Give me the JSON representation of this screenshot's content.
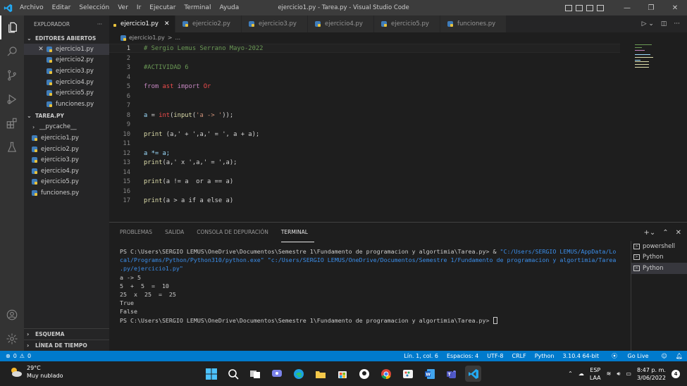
{
  "titlebar": {
    "menu": [
      "Archivo",
      "Editar",
      "Selección",
      "Ver",
      "Ir",
      "Ejecutar",
      "Terminal",
      "Ayuda"
    ],
    "window_title": "ejercicio1.py - Tarea.py - Visual Studio Code"
  },
  "sidebar": {
    "header": "EXPLORADOR",
    "open_editors_label": "EDITORES ABIERTOS",
    "open_editors": [
      "ejercicio1.py",
      "ejercicio2.py",
      "ejercicio3.py",
      "ejercicio4.py",
      "ejercicio5.py",
      "funciones.py"
    ],
    "folder_label": "TAREA.PY",
    "folder_items": [
      "__pycache__",
      "ejercicio1.py",
      "ejercicio2.py",
      "ejercicio3.py",
      "ejercicio4.py",
      "ejercicio5.py",
      "funciones.py"
    ],
    "outline_label": "ESQUEMA",
    "timeline_label": "LÍNEA DE TIEMPO"
  },
  "tabs": [
    {
      "label": "ejercicio1.py",
      "active": true
    },
    {
      "label": "ejercicio2.py",
      "active": false
    },
    {
      "label": "ejercicio3.py",
      "active": false
    },
    {
      "label": "ejercicio4.py",
      "active": false
    },
    {
      "label": "ejercicio5.py",
      "active": false
    },
    {
      "label": "funciones.py",
      "active": false
    }
  ],
  "breadcrumb": {
    "file": "ejercicio1.py",
    "sep": ">",
    "more": "..."
  },
  "editor": {
    "line_numbers": [
      "1",
      "2",
      "3",
      "4",
      "5",
      "6",
      "7",
      "8",
      "9",
      "10",
      "11",
      "12",
      "13",
      "14",
      "15",
      "16",
      "17"
    ],
    "line1": "# Sergio Lemus Serrano Mayo-2022",
    "line3": "#ACTIVIDAD 6",
    "line5": {
      "from": "from",
      "module": "ast",
      "import": "import",
      "name": "Or"
    },
    "line8": {
      "a": "a",
      "eq": " = ",
      "int": "int",
      "open": "(",
      "input": "input",
      "arg": "'a -> '",
      "close": "));"
    },
    "line10": {
      "print": "print",
      "rest": " (a,' + ',a,' = ', a + a);"
    },
    "line12": "a *= a;",
    "line13": {
      "print": "print",
      "rest": "(a,' x ',a,' = ',a);"
    },
    "line15": {
      "print": "print",
      "rest": "(a != a  or a == a)"
    },
    "line17": {
      "print": "print",
      "rest": "(a > a if a else a)"
    }
  },
  "panel": {
    "tabs": [
      "PROBLEMAS",
      "SALIDA",
      "CONSOLA DE DEPURACIÓN",
      "TERMINAL"
    ],
    "active_tab": "TERMINAL",
    "terminal_lines": [
      {
        "prompt": "PS C:\\Users\\SERGIO LEMUS\\OneDrive\\Documentos\\Semestre 1\\Fundamento de programacion y algortimia\\Tarea.py> ",
        "amp": "& ",
        "path1": "\"C:/Users/SERGIO LEMUS/AppData/Lo"
      },
      {
        "path": "cal/Programs/Python/Python310/python.exe\" \"c:/Users/SERGIO LEMUS/OneDrive/Documentos/Semestre 1/Fundamento de programacion y algortimia/Tarea"
      },
      {
        "path": ".py/ejercicio1.py\""
      },
      {
        "out": "a -> 5"
      },
      {
        "out": "5  +  5  =  10"
      },
      {
        "out": "25  x  25  =  25"
      },
      {
        "out": "True"
      },
      {
        "out": "False"
      },
      {
        "prompt": "PS C:\\Users\\SERGIO LEMUS\\OneDrive\\Documentos\\Semestre 1\\Fundamento de programacion y algortimia\\Tarea.py> "
      }
    ],
    "terminals": [
      "powershell",
      "Python",
      "Python"
    ]
  },
  "statusbar": {
    "errors": "0",
    "warnings": "0",
    "position": "Lín. 1, col. 6",
    "spaces": "Espacios: 4",
    "encoding": "UTF-8",
    "eol": "CRLF",
    "language": "Python",
    "interpreter": "3.10.4 64-bit",
    "golive": "Go Live"
  },
  "taskbar": {
    "temp": "29°C",
    "weather": "Muy nublado",
    "lang1": "ESP",
    "lang2": "LAA",
    "time": "8:47 p. m.",
    "date": "3/06/2022",
    "notifications": "4"
  },
  "colors": {
    "accent": "#007acc",
    "activity_bar": "#333333",
    "sidebar": "#252526",
    "editor_bg": "#1e1e1e"
  }
}
